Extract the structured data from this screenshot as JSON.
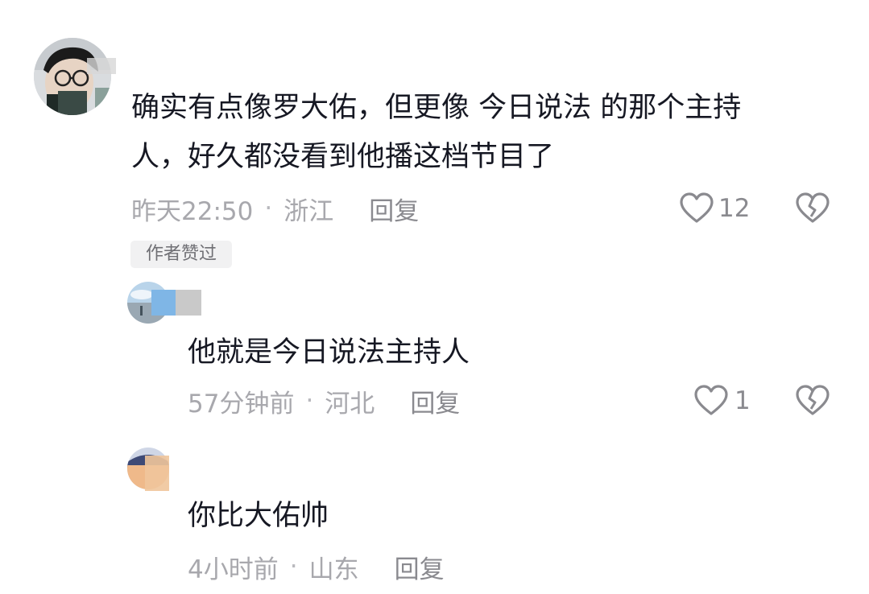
{
  "comments": [
    {
      "text_line1": "确实有点像罗大佑，但更像  今日说法   的那个主持",
      "text_line2": "人，好久都没看到他播这档节目了",
      "time": "昨天22:50",
      "location": "浙江",
      "reply_label": "回复",
      "likes": "12",
      "author_badge": "作者赞过"
    }
  ],
  "replies": [
    {
      "text": "他就是今日说法主持人",
      "time": "57分钟前",
      "location": "河北",
      "reply_label": "回复",
      "likes": "1"
    },
    {
      "username_partial": "",
      "text": "你比大佑帅",
      "time": "4小时前",
      "location": "山东",
      "reply_label": "回复"
    }
  ],
  "meta_separator": "·",
  "icons": {
    "like": "heart-outline-icon",
    "dislike": "broken-heart-icon"
  },
  "colors": {
    "text": "#161823",
    "meta": "#a8a8ad",
    "icon": "#8a8a8f"
  }
}
